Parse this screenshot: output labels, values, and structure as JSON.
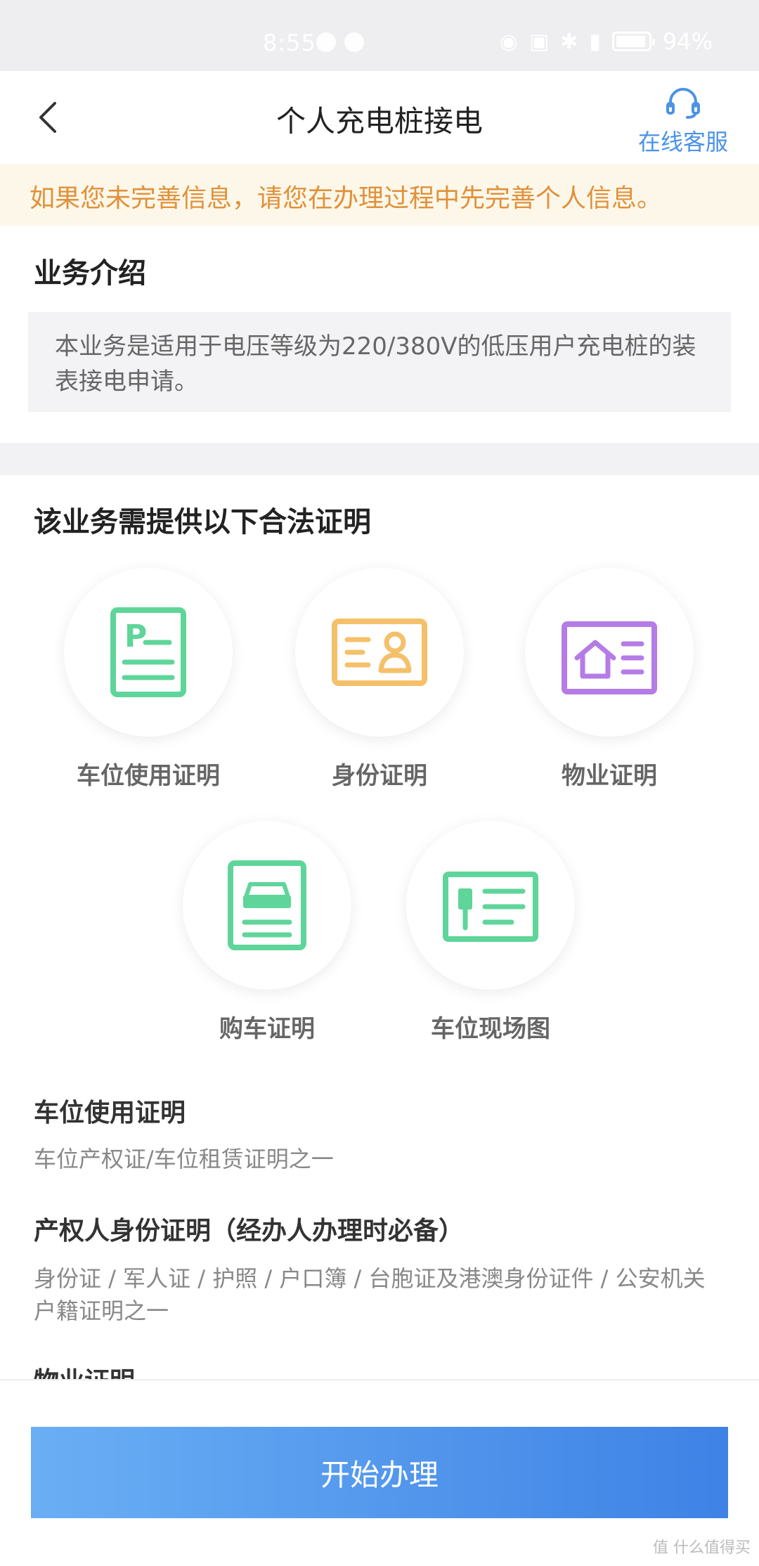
{
  "status_bar": {
    "time": "8:55",
    "battery": "94%",
    "battery_level": 0.94
  },
  "header": {
    "title": "个人充电桩接电",
    "service_label": "在线客服",
    "back_icon": "chevron-left-icon",
    "service_icon": "headset-icon"
  },
  "notice": {
    "text": "如果您未完善信息，请您在办理过程中先完善个人信息。"
  },
  "intro": {
    "title": "业务介绍",
    "text": "本业务是适用于电压等级为220/380V的低压用户充电桩的装表接电申请。"
  },
  "certs": {
    "title": "该业务需提供以下合法证明",
    "items": [
      {
        "label": "车位使用证明",
        "icon": "parking-document-icon",
        "color": "#5fd59a"
      },
      {
        "label": "身份证明",
        "icon": "id-card-icon",
        "color": "#f5c06a"
      },
      {
        "label": "物业证明",
        "icon": "property-card-icon",
        "color": "#b57be6"
      },
      {
        "label": "购车证明",
        "icon": "car-document-icon",
        "color": "#5fd59a"
      },
      {
        "label": "车位现场图",
        "icon": "charging-station-card-icon",
        "color": "#5fd59a"
      }
    ]
  },
  "details": [
    {
      "heading": "车位使用证明",
      "desc": "车位产权证/车位租赁证明之一"
    },
    {
      "heading": "产权人身份证明（经办人办理时必备）",
      "desc": "身份证 / 军人证 / 护照 / 户口簿 / 台胞证及港澳身份证件 / 公安机关户籍证明之一"
    },
    {
      "heading": "物业证明",
      "desc": ""
    }
  ],
  "action": {
    "start_label": "开始办理"
  },
  "watermark": "值 什么值得买",
  "colors": {
    "accent": "#4b93e6",
    "notice_text": "#e0913a",
    "notice_bg": "#fdf7e9",
    "button_start": "#6aaff4",
    "button_end": "#3e82e6"
  }
}
